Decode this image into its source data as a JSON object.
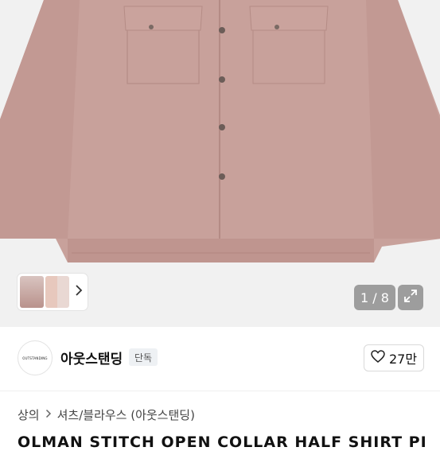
{
  "gallery": {
    "counter": "1 / 8",
    "thumb_chevron_icon": "chevron-right-icon",
    "expand_icon": "expand-icon"
  },
  "shop": {
    "logo_text": "OUTSTANDING",
    "name": "아웃스탠딩",
    "badge": "단독",
    "like_count": "27만"
  },
  "breadcrumb": {
    "items": [
      "상의",
      "셔츠/블라우스 (아웃스탠딩)"
    ]
  },
  "product": {
    "title": "OLMAN STITCH OPEN COLLAR HALF SHIRT PI"
  },
  "colors": {
    "shirt": "#c7a09a",
    "background": "#f1f1f1"
  }
}
